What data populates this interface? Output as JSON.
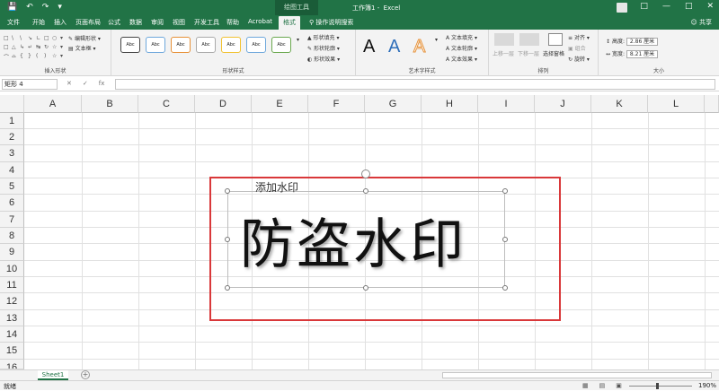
{
  "titlebar": {
    "context_tab": "绘图工具",
    "workbook": "工作簿1",
    "app": "Excel",
    "qa_icons": [
      "save-icon",
      "undo-icon",
      "redo-icon",
      "customize-icon"
    ]
  },
  "tabs": [
    "文件",
    "开始",
    "插入",
    "页面布局",
    "公式",
    "数据",
    "审阅",
    "视图",
    "开发工具",
    "帮助",
    "Acrobat",
    "格式"
  ],
  "active_tab": "格式",
  "search_hint": "操作说明搜索",
  "share_label": "共享",
  "ribbon": {
    "insert_shapes": {
      "label": "插入形状",
      "edit_shape": "编辑形状",
      "textbox": "文本框"
    },
    "shape_styles": {
      "label": "形状样式",
      "swatch_text": "Abc",
      "fill": "形状填充",
      "outline": "形状轮廓",
      "effects": "形状效果"
    },
    "wordart": {
      "label": "艺术字样式",
      "letter": "A",
      "text_fill": "文本填充",
      "text_outline": "文本轮廓",
      "text_effects": "文本效果"
    },
    "arrange": {
      "label": "排列",
      "bring_forward": "上移一层",
      "send_backward": "下移一层",
      "selection_pane": "选择窗格",
      "align": "对齐",
      "group": "组合",
      "rotate": "旋转"
    },
    "size": {
      "label": "大小",
      "height_label": "高度:",
      "height_value": "2.86 厘米",
      "width_label": "宽度:",
      "width_value": "8.21 厘米"
    }
  },
  "formula_bar": {
    "name_box": "矩形 4",
    "cancel": "✕",
    "enter": "✓",
    "fx": "fx",
    "value": ""
  },
  "columns": [
    "A",
    "B",
    "C",
    "D",
    "E",
    "F",
    "G",
    "H",
    "I",
    "J",
    "K",
    "L"
  ],
  "rows": [
    "1",
    "2",
    "3",
    "4",
    "5",
    "6",
    "7",
    "8",
    "9",
    "10",
    "11",
    "12",
    "13",
    "14",
    "15",
    "16"
  ],
  "shape": {
    "small_text": "添加水印",
    "big_text": "防盗水印"
  },
  "sheet_tab": "Sheet1",
  "statusbar": {
    "ready": "就绪",
    "zoom": "190%"
  },
  "colors": {
    "excel_green": "#217346",
    "highlight_red": "#d9383a"
  }
}
